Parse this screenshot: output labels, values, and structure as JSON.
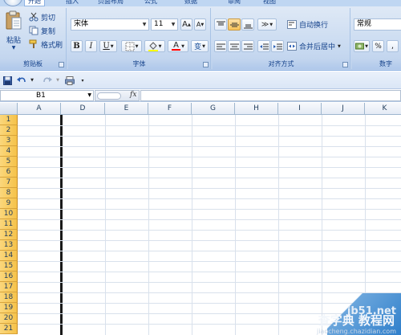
{
  "ribbon_tabs": [
    "开始",
    "插入",
    "页面布局",
    "公式",
    "数据",
    "审阅",
    "视图"
  ],
  "clipboard": {
    "paste_label": "粘贴",
    "cut_label": "剪切",
    "copy_label": "复制",
    "format_painter_label": "格式刷",
    "group_label": "剪贴板"
  },
  "font": {
    "font_name": "宋体",
    "font_size": "11",
    "bold_label": "B",
    "italic_label": "I",
    "underline_label": "U",
    "font_color_label": "A",
    "phonetic_label": "变",
    "grow_label": "A",
    "shrink_label": "A",
    "group_label": "字体"
  },
  "alignment": {
    "wrap_text_label": "自动换行",
    "merge_center_label": "合并后居中",
    "group_label": "对齐方式"
  },
  "number": {
    "format_value": "常规",
    "percent_label": "%",
    "comma_label": ",",
    "group_label": "数字"
  },
  "formula_bar": {
    "name_box": "B1",
    "fx_label": "fx",
    "formula": ""
  },
  "grid": {
    "columns": [
      "A",
      "D",
      "E",
      "F",
      "G",
      "H",
      "I",
      "J",
      "K"
    ],
    "rows": [
      "1",
      "2",
      "3",
      "4",
      "5",
      "6",
      "7",
      "8",
      "9",
      "10",
      "11",
      "12",
      "13",
      "14",
      "15",
      "16",
      "17",
      "18",
      "19",
      "20",
      "21"
    ]
  },
  "watermark": {
    "line1": "jb51.net",
    "line2": "查字典 教程网",
    "line3": "jiaocheng.chazidian.com"
  },
  "colors": {
    "ribbon_bg": "#c7d9f0",
    "row_header_selected": "#f5c24a",
    "gridline": "#d9e1ec",
    "text_blue": "#15428b"
  }
}
